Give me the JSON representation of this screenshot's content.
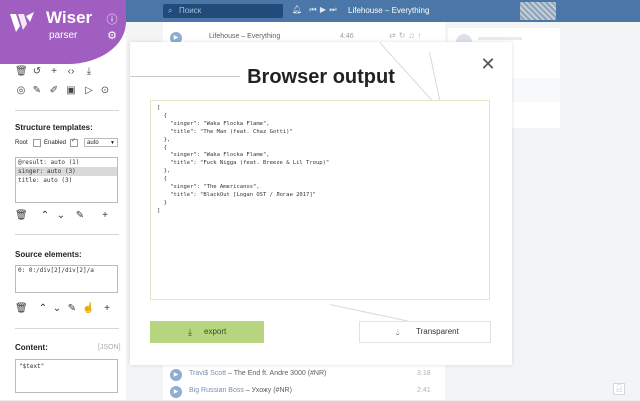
{
  "background": {
    "search_placeholder": "Поиск",
    "header_now_playing": "Lifehouse – Everything",
    "player": {
      "title": "Lifehouse – Everything",
      "time": "4:46"
    },
    "tracks": [
      {
        "artist": "Travi$ Scott",
        "title": "The End ft. Andre 3000 (#NR)",
        "time": "3:18"
      },
      {
        "artist": "Big Russian Boss",
        "title": "Ухожу (#NR)",
        "time": "2:41"
      }
    ]
  },
  "sidebar": {
    "logo_name": "Wiser",
    "logo_sub": "parser",
    "structure_templates": {
      "title": "Structure templates:",
      "root_label": "Root",
      "enabled_label": "Enabled",
      "mode_value": "auto",
      "items": [
        "@result: auto (1)",
        " singer: auto (3)",
        " title: auto (3)"
      ]
    },
    "source_elements": {
      "title": "Source elements:",
      "items": [
        "0: 0:/div[2]/div[2]/a"
      ]
    },
    "content": {
      "title": "Content:",
      "hint": "[JSON]",
      "value": "\"$text\""
    }
  },
  "modal": {
    "title": "Browser output",
    "output": "[\n  {\n    \"singer\": \"Waka Flocka Flame\",\n    \"title\": \"The Man (feat. Chaz Gotti)\"\n  },\n  {\n    \"singer\": \"Waka Flocka Flame\",\n    \"title\": \"Fuck Nigga (feat. Breeze & Lil Troup)\"\n  },\n  {\n    \"singer\": \"The Americanos\",\n    \"title\": \"BlackOut [Logan OST / Логан 2017]\"\n  }\n]",
    "export_label": "export",
    "transparent_label": "Transparent"
  }
}
